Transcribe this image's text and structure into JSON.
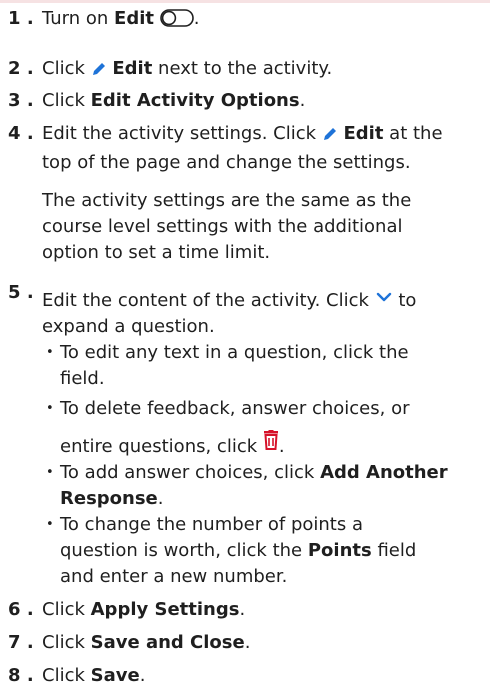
{
  "steps": [
    {
      "number": "1",
      "dot": ".",
      "pre": "Turn on ",
      "bold": "Edit"
    },
    {
      "number": "2",
      "dot": ".",
      "pre": "Click ",
      "bold": "Edit",
      "post": " next to the activity."
    },
    {
      "number": "3",
      "dot": ".",
      "pre": "Click ",
      "bold": "Edit Activity Options",
      "post": "."
    },
    {
      "number": "4",
      "dot": ".",
      "line1_pre": "Edit the activity settings. Click ",
      "line1_bold": "Edit",
      "line1_post": " at the",
      "line2": "top of the page and change the settings.",
      "para2_l1": "The activity settings are the same as the",
      "para2_l2": "course level settings with the additional",
      "para2_l3": "option to set a time limit."
    },
    {
      "number": "5",
      "dot": ".",
      "l1_pre": "Edit the content of the activity. Click ",
      "l1_post": " to",
      "l2": "expand a question.",
      "bullets": {
        "b1_l1": "To edit any text in a question, click the",
        "b1_l2": "field.",
        "b2_l1": "To delete feedback, answer choices, or",
        "b2_l2": "entire questions, click ",
        "b2_post": ".",
        "b3_l1_pre": "To add answer choices, click ",
        "b3_l1_bold": "Add Another",
        "b3_l2_bold": "Response",
        "b3_l2_post": ".",
        "b4_l1": "To change the number of points a",
        "b4_l2_pre": "question is worth, click the ",
        "b4_l2_bold": "Points",
        "b4_l2_post": " field",
        "b4_l3": "and enter a new number."
      }
    },
    {
      "number": "6",
      "dot": ".",
      "pre": "Click ",
      "bold": "Apply Settings",
      "post": "."
    },
    {
      "number": "7",
      "dot": ".",
      "pre": "Click ",
      "bold": "Save and Close",
      "post": "."
    },
    {
      "number": "8",
      "dot": ".",
      "pre": "Click ",
      "bold": "Save",
      "post": "."
    }
  ],
  "icons": {
    "toggle": "toggle-off-icon",
    "pencil": "pencil-icon",
    "chevron": "chevron-down-icon",
    "trash": "trash-icon"
  },
  "colors": {
    "pencil": "#1e73d8",
    "chevron": "#1e73d8",
    "trash": "#d6122a",
    "text": "#1f1f1f"
  }
}
